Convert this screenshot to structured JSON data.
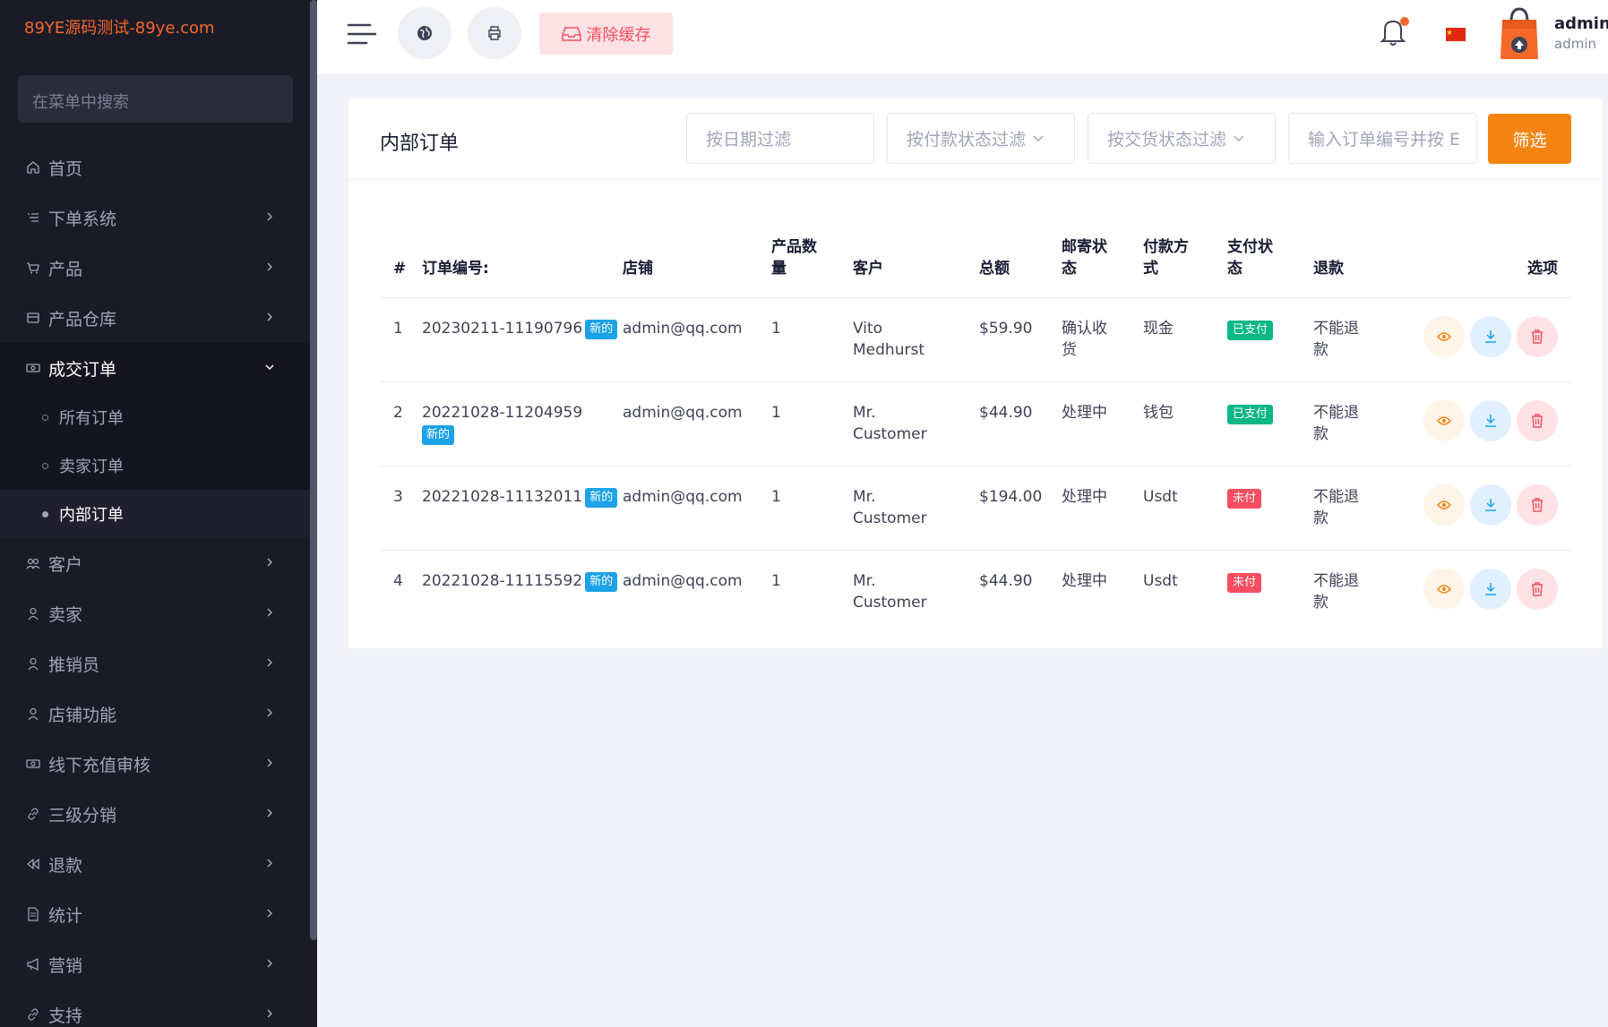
{
  "sidebar": {
    "brand": "89YE源码测试-89ye.com",
    "search_placeholder": "在菜单中搜索",
    "items": [
      {
        "label": "首页",
        "icon": "home-icon"
      },
      {
        "label": "下单系统",
        "icon": "list-icon"
      },
      {
        "label": "产品",
        "icon": "cart-icon"
      },
      {
        "label": "产品仓库",
        "icon": "warehouse-icon"
      },
      {
        "label": "成交订单",
        "icon": "money-icon"
      },
      {
        "label": "客户",
        "icon": "users-icon"
      },
      {
        "label": "卖家",
        "icon": "user-icon"
      },
      {
        "label": "推销员",
        "icon": "user-icon"
      },
      {
        "label": "店铺功能",
        "icon": "user-icon"
      },
      {
        "label": "线下充值审核",
        "icon": "money-icon"
      },
      {
        "label": "三级分销",
        "icon": "link-icon"
      },
      {
        "label": "退款",
        "icon": "backward-icon"
      },
      {
        "label": "统计",
        "icon": "file-icon"
      },
      {
        "label": "营销",
        "icon": "megaphone-icon"
      },
      {
        "label": "支持",
        "icon": "link-icon"
      }
    ],
    "sub_items": [
      "所有订单",
      "卖家订单",
      "内部订单"
    ]
  },
  "header": {
    "clear_cache": "清除缓存",
    "user_name": "admin",
    "user_role": "admin"
  },
  "card": {
    "title": "内部订单",
    "filter_date": "按日期过滤",
    "filter_payment": "按付款状态过滤",
    "filter_delivery": "按交货状态过滤",
    "filter_code": "输入订单编号并按 E",
    "filter_button": "筛选"
  },
  "table": {
    "headers": {
      "idx": "#",
      "code": "订单编号:",
      "shop": "店铺",
      "qty": "产品数量",
      "customer": "客户",
      "total": "总额",
      "shipping": "邮寄状态",
      "payment_method": "付款方式",
      "payment_status": "支付状态",
      "refund": "退款",
      "options": "选项"
    },
    "new_badge": "新的",
    "rows": [
      {
        "idx": "1",
        "code": "20230211-11190796",
        "shop": "admin@qq.com",
        "qty": "1",
        "customer": "Vito Medhurst",
        "total": "$59.90",
        "shipping": "确认收货",
        "payment_method": "现金",
        "payment_status": "已支付",
        "paid": true,
        "refund": "不能退款"
      },
      {
        "idx": "2",
        "code": "20221028-11204959",
        "shop": "admin@qq.com",
        "qty": "1",
        "customer": "Mr. Customer",
        "total": "$44.90",
        "shipping": "处理中",
        "payment_method": "钱包",
        "payment_status": "已支付",
        "paid": true,
        "refund": "不能退款"
      },
      {
        "idx": "3",
        "code": "20221028-11132011",
        "shop": "admin@qq.com",
        "qty": "1",
        "customer": "Mr. Customer",
        "total": "$194.00",
        "shipping": "处理中",
        "payment_method": "Usdt",
        "payment_status": "未付",
        "paid": false,
        "refund": "不能退款"
      },
      {
        "idx": "4",
        "code": "20221028-11115592",
        "shop": "admin@qq.com",
        "qty": "1",
        "customer": "Mr. Customer",
        "total": "$44.90",
        "shipping": "处理中",
        "payment_method": "Usdt",
        "payment_status": "未付",
        "paid": false,
        "refund": "不能退款"
      }
    ]
  },
  "colors": {
    "accent": "#f68412",
    "sidebar_bg": "#1b1b28",
    "new_badge": "#1ba2e8",
    "paid_badge": "#0bb783",
    "unpaid_badge": "#f64e60"
  }
}
